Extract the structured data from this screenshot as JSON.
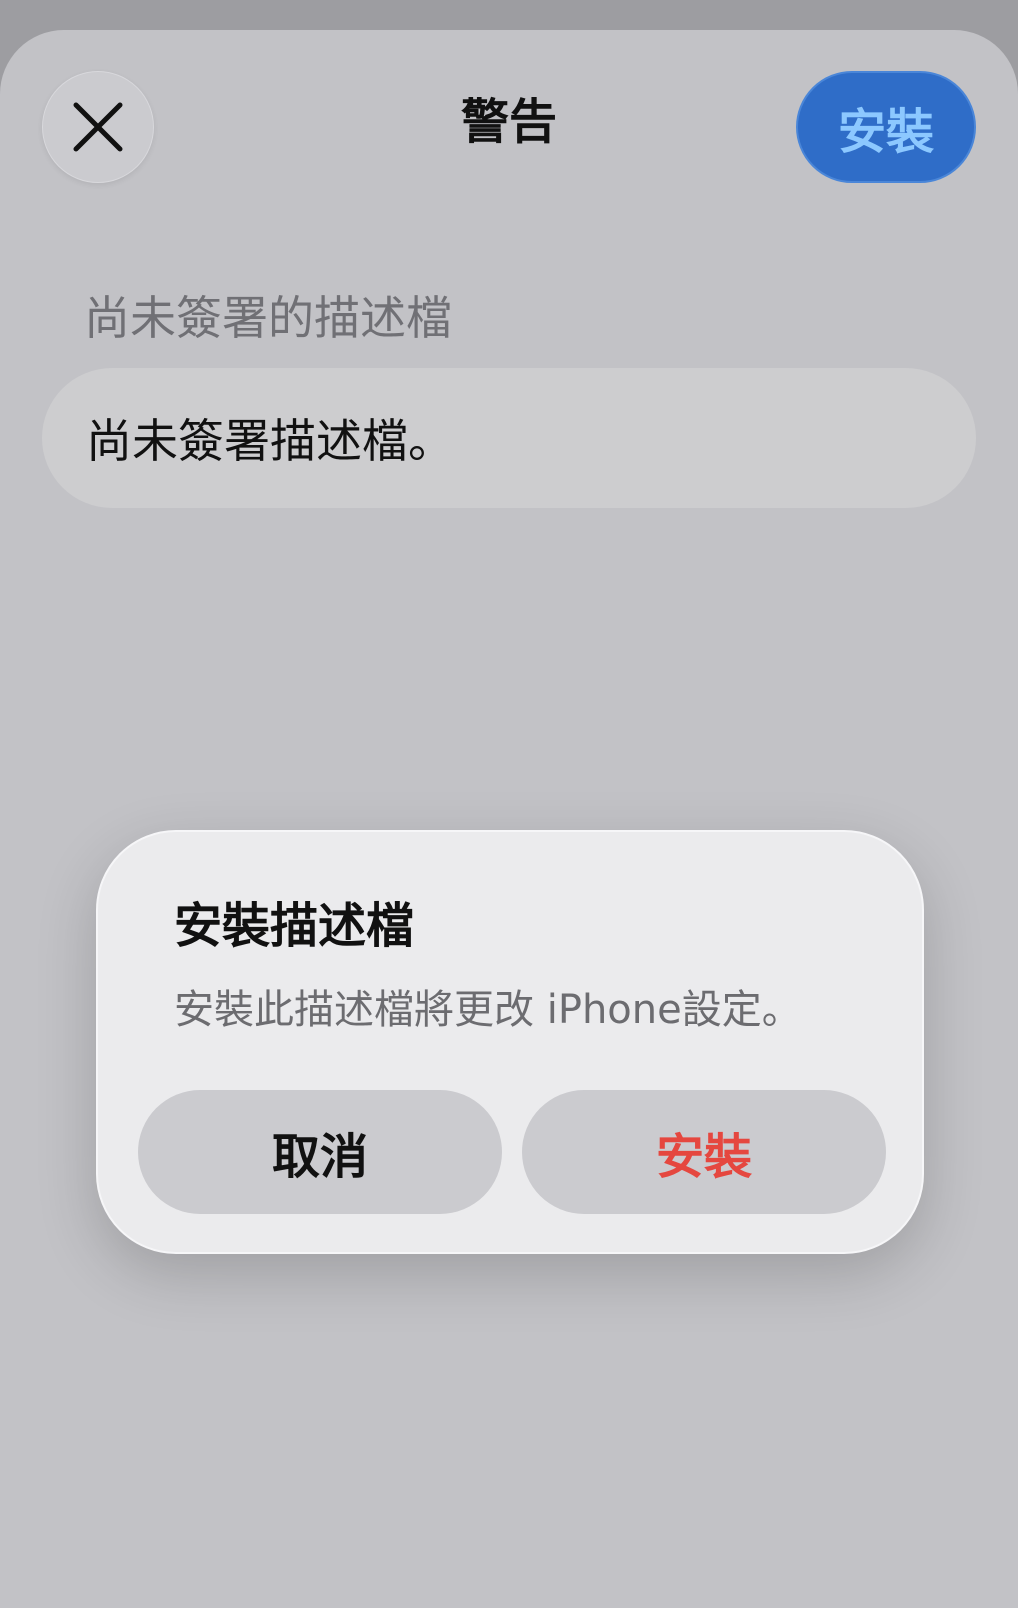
{
  "nav": {
    "title": "警告",
    "install_label": "安裝"
  },
  "section": {
    "header": "尚未簽署的描述檔",
    "card_text": "尚未簽署描述檔。"
  },
  "alert": {
    "title": "安裝描述檔",
    "message": "安裝此描述檔將更改 iPhone設定。",
    "cancel_label": "取消",
    "install_label": "安裝"
  },
  "colors": {
    "accent_blue": "#2f6dc8",
    "destructive_red": "#e5473f"
  },
  "icons": {
    "close": "close-icon"
  }
}
